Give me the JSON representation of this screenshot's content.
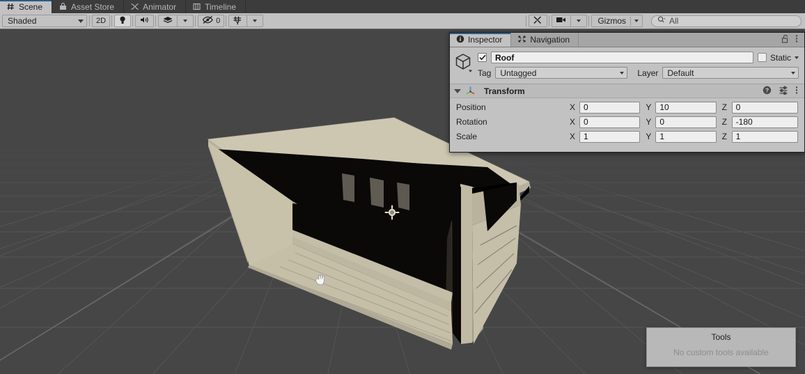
{
  "window": {
    "tabs": [
      {
        "label": "Scene",
        "icon": "grid-icon",
        "active": true
      },
      {
        "label": "Asset Store",
        "icon": "store-icon",
        "active": false
      },
      {
        "label": "Animator",
        "icon": "animator-icon",
        "active": false
      },
      {
        "label": "Timeline",
        "icon": "timeline-icon",
        "active": false
      }
    ]
  },
  "scene_toolbar": {
    "draw_mode": "Shaded",
    "two_d_label": "2D",
    "lighting_icon": "lightbulb-icon",
    "audio_icon": "speaker-icon",
    "effects_icon": "effects-icon",
    "hidden_count": "0",
    "hidden_icon": "eye-off-icon",
    "grid_icon": "grid-visibility-icon",
    "tools_icon": "tools-icon",
    "camera_icon": "camera-icon",
    "gizmos_label": "Gizmos",
    "search_placeholder": "All",
    "search_value": "",
    "search_icon": "search-icon"
  },
  "scene": {
    "background_color": "#464646",
    "grid_color": "#555555",
    "building": {
      "roof_top_color": "#cdc7b2",
      "wall_light_color": "#c9c2ab",
      "wall_mid_color": "#b7b09a",
      "wall_dark_color": "#3a352d",
      "interior_color": "#090806",
      "steps_color": "#c6bfa8",
      "pillar_color": "#5e5a52"
    },
    "light_gizmo_icon": "point-light-gizmo",
    "cursor_icon": "hand-cursor"
  },
  "inspector": {
    "tabs": [
      {
        "label": "Inspector",
        "icon": "info-icon",
        "active": true
      },
      {
        "label": "Navigation",
        "icon": "navigation-icon",
        "active": false
      }
    ],
    "lock_icon": "lock-open-icon",
    "menu_icon": "kebab-menu-icon",
    "object": {
      "icon": "prefab-cube-icon",
      "enabled": true,
      "name": "Roof",
      "static_label": "Static",
      "static_checked": false,
      "tag_label": "Tag",
      "tag_value": "Untagged",
      "layer_label": "Layer",
      "layer_value": "Default"
    },
    "transform": {
      "title": "Transform",
      "icon": "transform-axis-icon",
      "expanded": true,
      "help_icon": "help-icon",
      "preset_icon": "preset-icon",
      "menu_icon": "kebab-menu-icon",
      "rows": [
        {
          "label": "Position",
          "x": "0",
          "y": "10",
          "z": "0"
        },
        {
          "label": "Rotation",
          "x": "0",
          "y": "0",
          "z": "-180"
        },
        {
          "label": "Scale",
          "x": "1",
          "y": "1",
          "z": "1"
        }
      ],
      "axis_labels": {
        "x": "X",
        "y": "Y",
        "z": "Z"
      }
    }
  },
  "tools_panel": {
    "title": "Tools",
    "empty_message": "No custom tools available"
  }
}
